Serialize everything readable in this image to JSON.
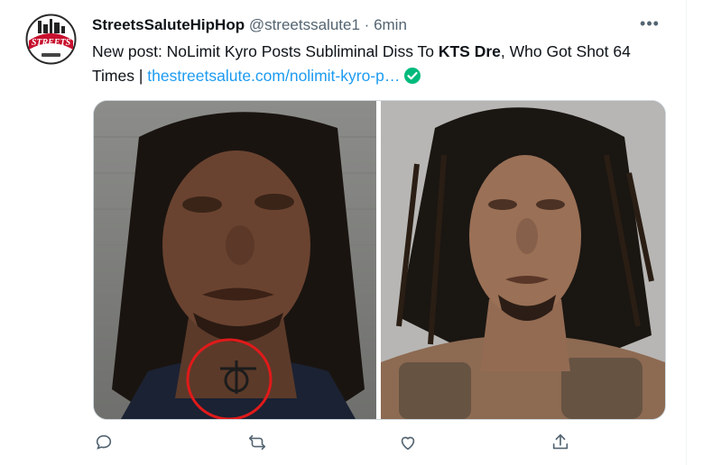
{
  "tweet": {
    "display_name": "StreetsSaluteHipHop",
    "handle": "@streetssalute1",
    "separator": "·",
    "time": "6min",
    "more_label": "•••",
    "avatar_text": "STREETS",
    "body": {
      "part1": "New post: NoLimit Kyro Posts Subliminal Diss To ",
      "bold": "KTS Dre",
      "part2": ", Who Got Shot 64 Times | ",
      "link": "thestreetsalute.com/nolimit-kyro-p…"
    }
  },
  "actions": [
    "reply-icon",
    "retweet-icon",
    "like-icon",
    "share-icon"
  ]
}
